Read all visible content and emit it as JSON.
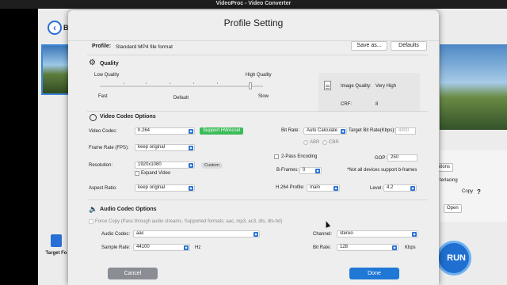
{
  "window": {
    "title": "VideoProc - Video Converter"
  },
  "background_app": {
    "back_letter": "B",
    "target_format_label": "Target Fo",
    "run_label": "RUN",
    "side_buttons": [
      "otions",
      "Open"
    ],
    "side_texts": [
      "terlacing",
      "Copy",
      "?"
    ]
  },
  "dialog": {
    "title": "Profile Setting",
    "profile_label": "Profile:",
    "profile_value": "Standard MP4 file format",
    "save_as_label": "Save as...",
    "defaults_label": "Defaults",
    "quality": {
      "section_title": "Quality",
      "low_quality": "Low Quality",
      "high_quality": "High Quality",
      "fast": "Fast",
      "default": "Default",
      "slow": "Slow",
      "slider_level": 0.92,
      "image_quality_label": "Image Quality:",
      "image_quality_value": "Very High",
      "crf_label": "CRF:",
      "crf_value": "8"
    },
    "video": {
      "section_title": "Video Codec Options",
      "codec_label": "Video Codec:",
      "codec_value": "h.264",
      "hwaccel_label": "Support HWAccel",
      "bitrate_label": "Bit Rate:",
      "bitrate_value": "Auto Calculate",
      "target_bitrate_label": "Target Bit Rate(Kbps):",
      "target_bitrate_value": "4900",
      "abr_label": "ABR",
      "cbr_label": "CBR",
      "fps_label": "Frame Rate (FPS):",
      "fps_value": "keep original",
      "two_pass_label": "2-Pass Encoding",
      "gop_label": "GOP:",
      "gop_value": "250",
      "resolution_label": "Resolution:",
      "resolution_value": "1920x1080",
      "custom_label": "Custom",
      "expand_video_label": "Expand Video",
      "bframes_label": "B-Frames:",
      "bframes_value": "0",
      "bframes_note": "*Not all devices support b-frames",
      "aspect_label": "Aspect Ratio:",
      "aspect_value": "keep original",
      "h264_profile_label": "H.264 Profile:",
      "h264_profile_value": "main",
      "level_label": "Level:",
      "level_value": "4.2"
    },
    "audio": {
      "section_title": "Audio Codec Options",
      "force_copy_label": "Force Copy (Pass through audio streams. Supported formats: aac, mp3, ac3, dts, dts-hd)",
      "codec_label": "Audio Codec:",
      "codec_value": "aac",
      "channel_label": "Channel:",
      "channel_value": "stereo",
      "sample_rate_label": "Sample Rate:",
      "sample_rate_value": "44100",
      "sample_rate_unit": "Hz",
      "bitrate_label": "Bit Rate:",
      "bitrate_value": "128",
      "bitrate_unit": "Kbps"
    },
    "cancel_label": "Cancel",
    "done_label": "Done"
  },
  "colors": {
    "accent": "#1f78d6",
    "hwaccel": "#3dbb5a",
    "cancel": "#8a8d93"
  }
}
